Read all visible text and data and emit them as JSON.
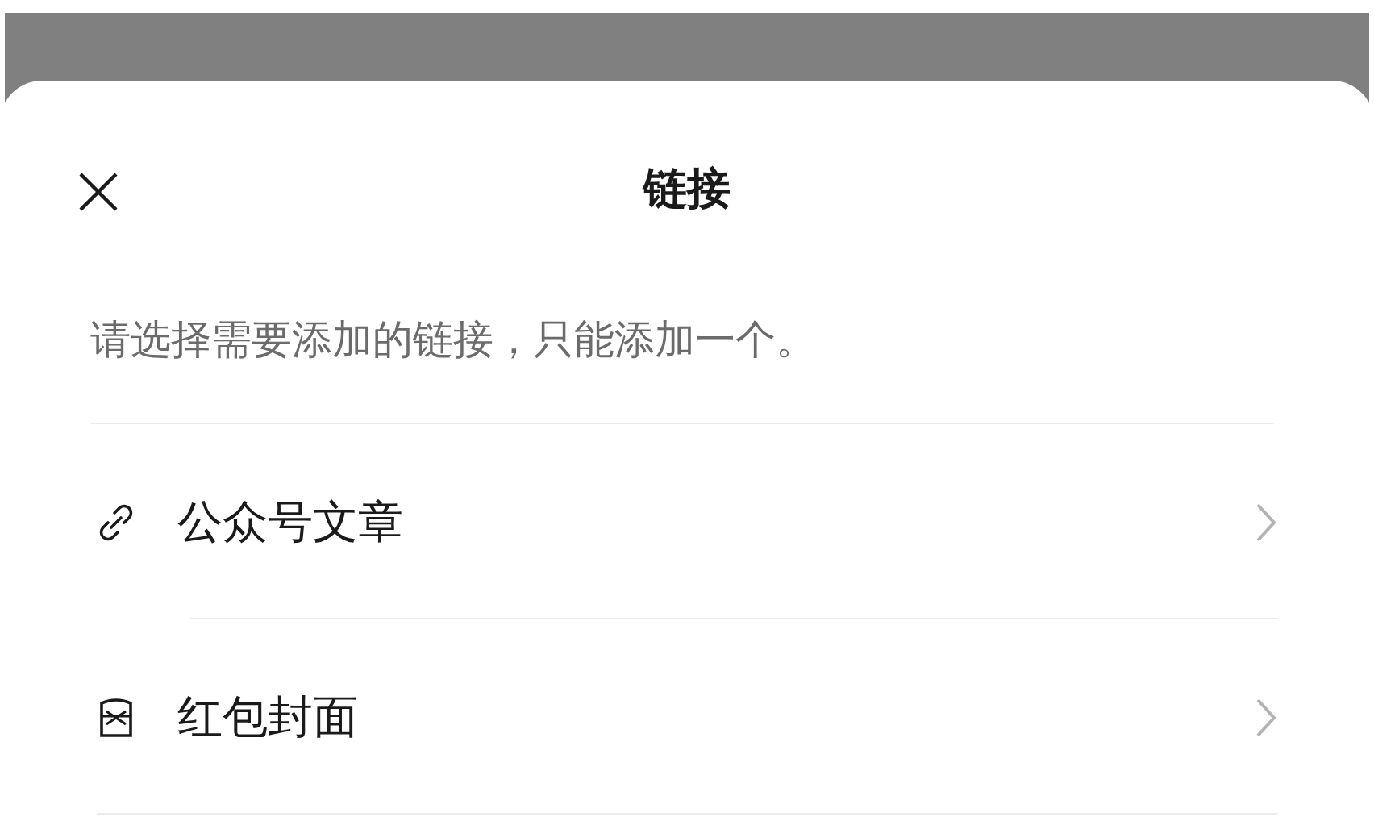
{
  "sheet": {
    "title": "链接",
    "hint": "请选择需要添加的链接，只能添加一个。"
  },
  "items": [
    {
      "kind": "link",
      "label": "公众号文章"
    },
    {
      "kind": "cover",
      "label": "红包封面"
    }
  ]
}
